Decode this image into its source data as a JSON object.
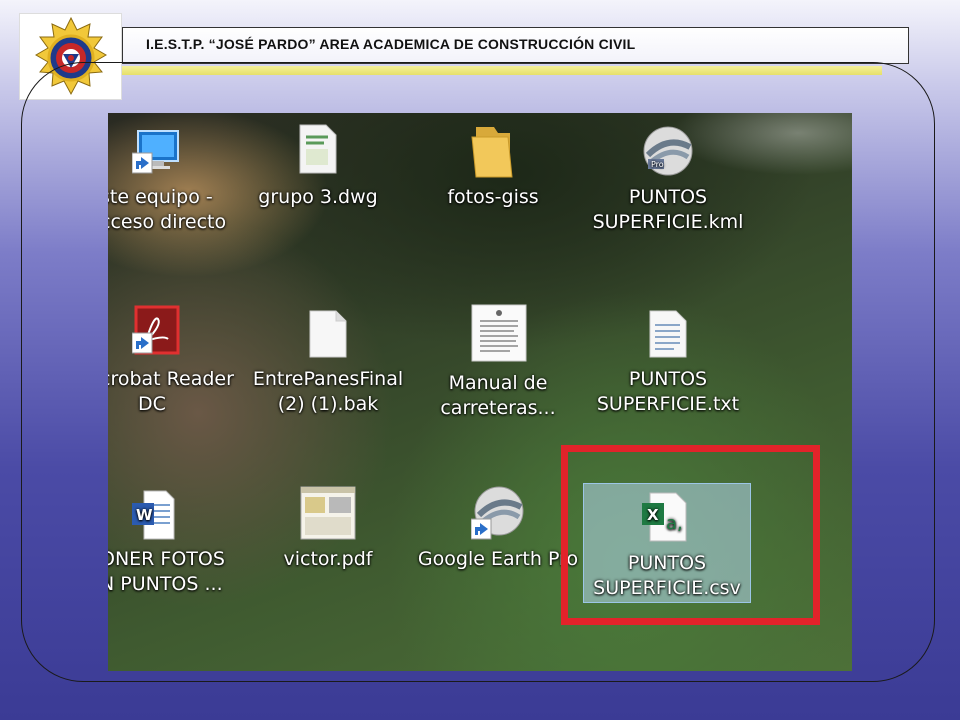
{
  "header": {
    "title": "I.E.S.T.P. “JOSÉ PARDO” AREA ACADEMICA DE CONSTRUCCIÓN CIVIL"
  },
  "desktop": {
    "icons": [
      {
        "label_lines": [
          "ste equipo -",
          "cceso directo"
        ],
        "icon": "monitor-shortcut-icon"
      },
      {
        "label_lines": [
          "grupo 3.dwg"
        ],
        "icon": "dwg-file-icon"
      },
      {
        "label_lines": [
          "fotos-giss"
        ],
        "icon": "folder-icon"
      },
      {
        "label_lines": [
          "PUNTOS",
          "SUPERFICIE.kml"
        ],
        "icon": "google-earth-pro-icon"
      },
      {
        "label_lines": [
          "crobat Reader",
          "DC"
        ],
        "icon": "acrobat-shortcut-icon"
      },
      {
        "label_lines": [
          "EntrePanesFinal",
          "(2) (1).bak"
        ],
        "icon": "blank-file-icon"
      },
      {
        "label_lines": [
          "Manual de",
          "carreteras..."
        ],
        "icon": "document-page-icon"
      },
      {
        "label_lines": [
          "PUNTOS",
          "SUPERFICIE.txt"
        ],
        "icon": "text-file-icon"
      },
      {
        "label_lines": [
          "ONER FOTOS",
          "N PUNTOS ..."
        ],
        "icon": "word-file-icon"
      },
      {
        "label_lines": [
          "victor.pdf"
        ],
        "icon": "pdf-thumbnail-icon"
      },
      {
        "label_lines": [
          "Google Earth Pro"
        ],
        "icon": "google-earth-pro-shortcut-icon"
      },
      {
        "label_lines": [
          "PUNTOS",
          "SUPERFICIE.csv"
        ],
        "icon": "excel-csv-icon",
        "selected": true
      }
    ]
  },
  "colors": {
    "highlight_border": "#e2232a",
    "selection_fill": "#b4d7f0",
    "header_accent": "#e6e06a"
  }
}
